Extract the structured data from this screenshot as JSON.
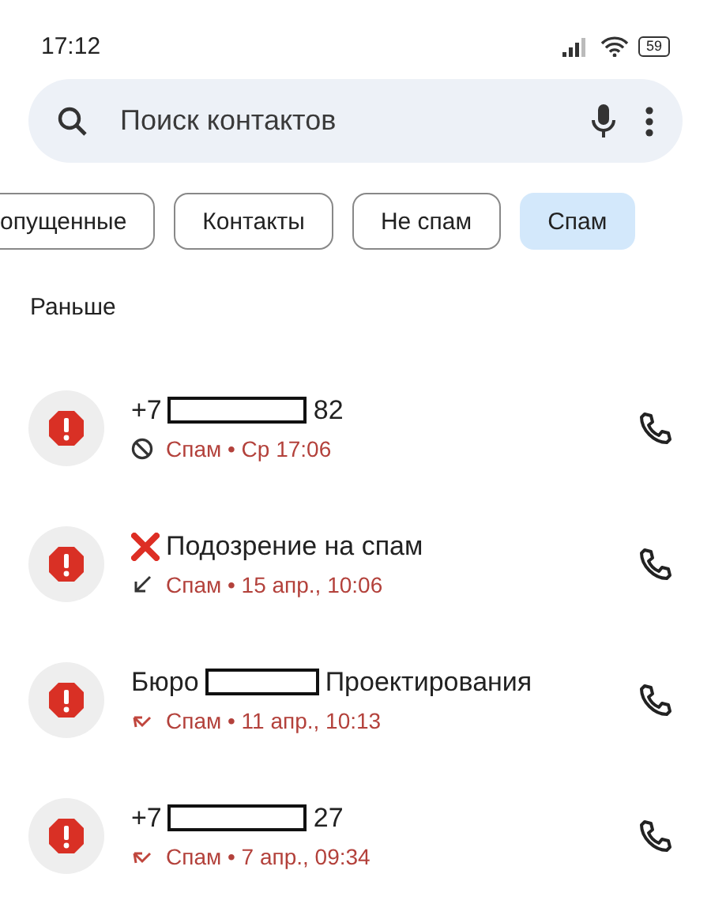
{
  "status_bar": {
    "time": "17:12",
    "battery": "59"
  },
  "search": {
    "placeholder": "Поиск контактов"
  },
  "chips": [
    {
      "label": "опущенные",
      "selected": false,
      "cut": true
    },
    {
      "label": "Контакты",
      "selected": false,
      "cut": false
    },
    {
      "label": "Не спам",
      "selected": false,
      "cut": false
    },
    {
      "label": "Спам",
      "selected": true,
      "cut": false
    }
  ],
  "section": "Раньше",
  "calls": [
    {
      "name_before": "+7",
      "redacted": true,
      "name_after": "82",
      "cross_mark": false,
      "kind": "blocked",
      "detail": "Спам • Ср 17:06"
    },
    {
      "name_before": "Подозрение на спам",
      "redacted": false,
      "cross_mark": true,
      "kind": "incoming",
      "detail": "Спам • 15 апр., 10:06"
    },
    {
      "name_before": "Бюро",
      "redacted": true,
      "name_after": "Проектирования",
      "cross_mark": false,
      "kind": "missed",
      "detail": "Спам • 11 апр., 10:13"
    },
    {
      "name_before": "+7",
      "redacted": true,
      "name_after": "27",
      "cross_mark": false,
      "kind": "missed",
      "detail": "Спам • 7 апр., 09:34"
    }
  ]
}
